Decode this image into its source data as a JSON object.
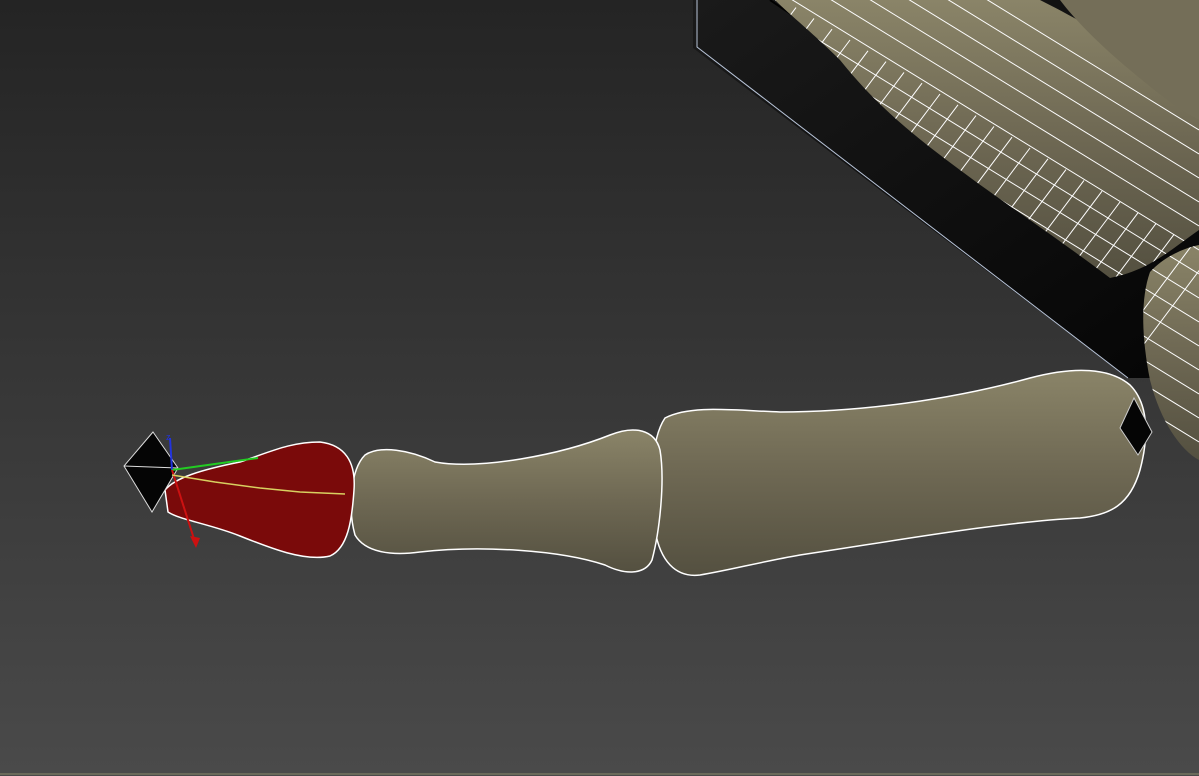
{
  "viewport": {
    "label": "",
    "background_top": "#242424",
    "background_bottom": "#4a4a4a"
  },
  "scene": {
    "bone_color": "#6e6853",
    "bone_highlight": "#8a8468",
    "selection_color": "#7a0a0a",
    "wire_color": "#ffffff",
    "gizmo_colors": {
      "x": "#cc1111",
      "y": "#22cc22",
      "z": "#2233dd",
      "trajectory": "#d8d060"
    },
    "objects": [
      {
        "name": "distal-phalanx",
        "selected": true,
        "icon": "bone-mesh"
      },
      {
        "name": "middle-phalanx",
        "selected": false,
        "icon": "bone-mesh"
      },
      {
        "name": "proximal-phalanx",
        "selected": false,
        "icon": "bone-mesh"
      },
      {
        "name": "metacarpal-upper",
        "selected": false,
        "icon": "bone-mesh"
      },
      {
        "name": "palm-block",
        "selected": false,
        "icon": "box-mesh"
      },
      {
        "name": "bone-end-helper",
        "selected": false,
        "icon": "helper-diamond"
      },
      {
        "name": "bone-tip-helper",
        "selected": false,
        "icon": "helper-diamond"
      }
    ]
  }
}
